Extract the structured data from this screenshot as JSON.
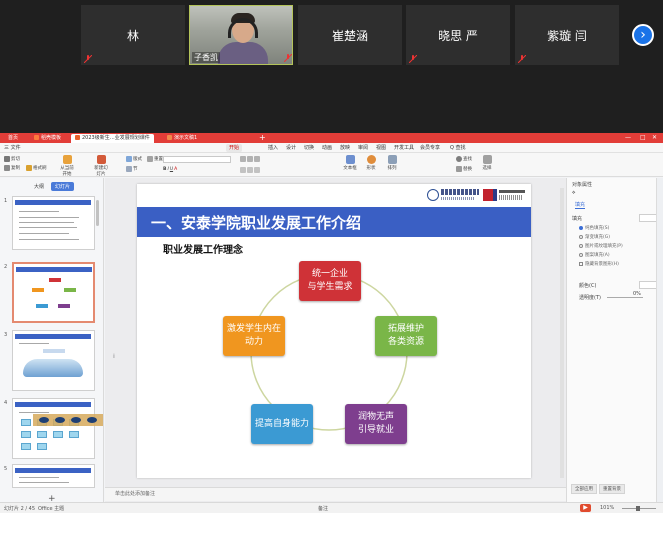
{
  "meeting": {
    "participants": [
      {
        "name": "林",
        "video": false
      },
      {
        "name": "子香凯",
        "video": true
      },
      {
        "name": "崔楚涵",
        "video": false
      },
      {
        "name": "晓思 严",
        "video": false
      },
      {
        "name": "紫璇 闫",
        "video": false
      }
    ],
    "next_icon": "chevron-right-icon"
  },
  "wps": {
    "tabs": [
      "首页",
      "稻壳模板",
      "2023级新生…业发展规划课件",
      "演示文稿1"
    ],
    "menu": [
      "三 文件",
      "开始",
      "插入",
      "设计",
      "切换",
      "动画",
      "放映",
      "审阅",
      "视图",
      "开发工具",
      "会员专享",
      "Q 查找"
    ],
    "active_menu": "开始",
    "toolbar": {
      "new_slide": "新建幻灯片",
      "layout": "版式",
      "section": "节",
      "reset": "重置",
      "cut": "剪切",
      "copy": "复制",
      "format_painter": "格式刷",
      "from_current": "从当前开始",
      "text_box": "文本框",
      "shape": "形状",
      "arrange": "排列",
      "find": "查找",
      "replace": "替换",
      "select": "选择"
    },
    "left_pane": {
      "tabs": [
        "大纲",
        "幻灯片"
      ],
      "active_tab": "幻灯片",
      "slide_numbers": [
        "1",
        "2",
        "3",
        "4",
        "5"
      ]
    },
    "slide": {
      "title": "一、安泰学院职业发展工作介绍",
      "subtitle": "职业发展工作理念",
      "cycle_nodes": [
        {
          "line1": "统一企业",
          "line2": "与学生需求",
          "color": "#cf3237"
        },
        {
          "line1": "拓展维护",
          "line2": "各类资源",
          "color": "#7ab648"
        },
        {
          "line1": "润物无声",
          "line2": "引导就业",
          "color": "#7e3e8e"
        },
        {
          "line1": "提高自身能力",
          "line2": "",
          "color": "#3b9ad3"
        },
        {
          "line1": "激发学生内在",
          "line2": "动力",
          "color": "#f0961f"
        }
      ],
      "ring_color": "#cdd6a0"
    },
    "notes_placeholder": "单击此处添加备注",
    "right_pane": {
      "title": "对象属性",
      "tab": "填充",
      "section": "填充",
      "options": [
        "纯色填充(S)",
        "渐变填充(G)",
        "图片或纹理填充(P)",
        "图案填充(A)",
        "隐藏背景图形(H)"
      ],
      "selected_option": "纯色填充(S)",
      "color_label": "颜色(C)",
      "transparency_label": "透明度(T)",
      "transparency_value": "0%",
      "bottom_tabs": [
        "全部应用",
        "重置背景"
      ]
    },
    "status": {
      "slide_position": "幻灯片 2 / 45",
      "theme": "Office 主题",
      "notes_toggle": "备注",
      "zoom": "101%"
    }
  }
}
